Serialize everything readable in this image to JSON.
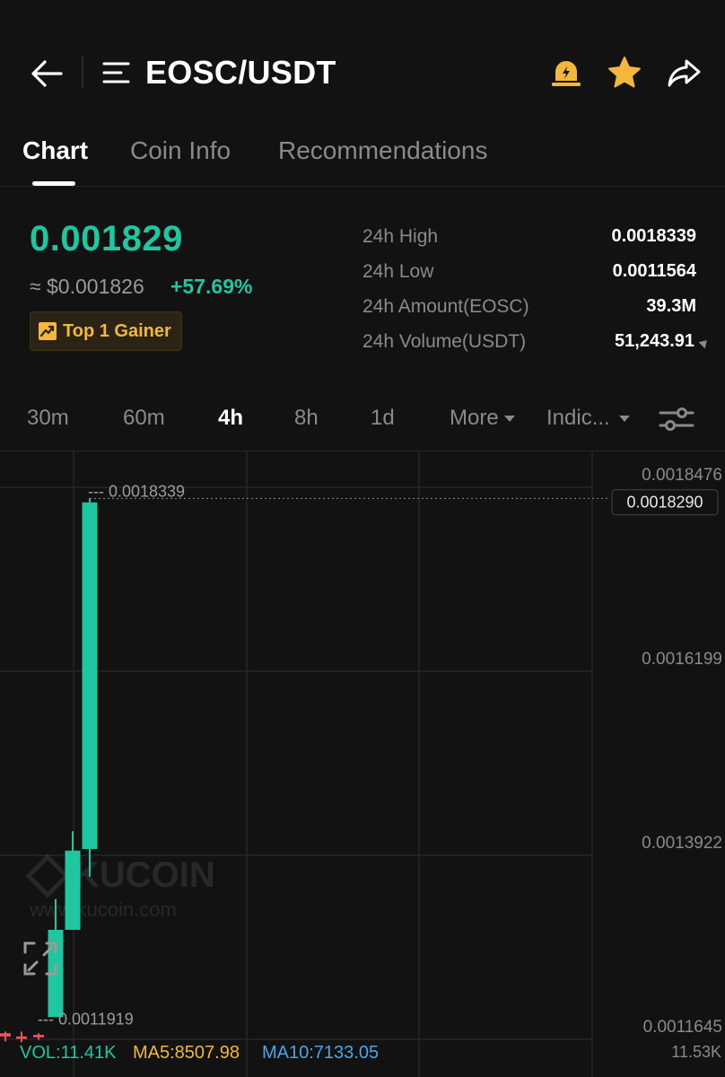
{
  "header": {
    "pair": "EOSC/USDT",
    "icons": [
      "back-arrow-icon",
      "menu-icon",
      "alert-bell-icon",
      "star-icon",
      "share-icon"
    ],
    "accent_color": "#f3b73b"
  },
  "tabs": [
    {
      "label": "Chart",
      "active": true
    },
    {
      "label": "Coin Info",
      "active": false
    },
    {
      "label": "Recommendations",
      "active": false
    }
  ],
  "ticker": {
    "price": "0.001829",
    "usd_approx": "≈ $0.001826",
    "change": "+57.69%",
    "badge": "Top 1 Gainer",
    "up_color": "#1fc7a0",
    "down_color": "#f0515a"
  },
  "stats": [
    {
      "label": "24h High",
      "value": "0.0018339"
    },
    {
      "label": "24h Low",
      "value": "0.0011564"
    },
    {
      "label": "24h Amount(EOSC)",
      "value": "39.3M"
    },
    {
      "label": "24h Volume(USDT)",
      "value": "51,243.91"
    }
  ],
  "intervals": {
    "items": [
      "30m",
      "60m",
      "4h",
      "8h",
      "1d"
    ],
    "active": "4h",
    "more_label": "More",
    "indicators_label": "Indic..."
  },
  "chart_data": {
    "type": "candlestick",
    "y_axis_labels": [
      "0.0018476",
      "0.0016199",
      "0.0013922",
      "0.0011645"
    ],
    "current_price_label": "0.0018290",
    "high_marker": "--- 0.0018339",
    "low_marker": "--- 0.0011919",
    "candles": [
      {
        "open": 0.001172,
        "close": 0.001168,
        "high": 0.001174,
        "low": 0.001162,
        "dir": "down"
      },
      {
        "open": 0.001168,
        "close": 0.001165,
        "high": 0.001174,
        "low": 0.001161,
        "dir": "down"
      },
      {
        "open": 0.00117,
        "close": 0.001167,
        "high": 0.001172,
        "low": 0.001164,
        "dir": "down"
      },
      {
        "open": 0.001192,
        "close": 0.0013,
        "high": 0.001338,
        "low": 0.001192,
        "dir": "up"
      },
      {
        "open": 0.0013,
        "close": 0.001398,
        "high": 0.001422,
        "low": 0.0013,
        "dir": "up"
      },
      {
        "open": 0.0014,
        "close": 0.001829,
        "high": 0.001834,
        "low": 0.001366,
        "dir": "up"
      }
    ],
    "grid": true,
    "watermark_logo": "KUCOIN",
    "watermark_url": "www.kucoin.com"
  },
  "volume": {
    "vol": "VOL:11.41K",
    "ma5": "MA5:8507.98",
    "ma10": "MA10:7133.05",
    "axis": "11.53K"
  }
}
